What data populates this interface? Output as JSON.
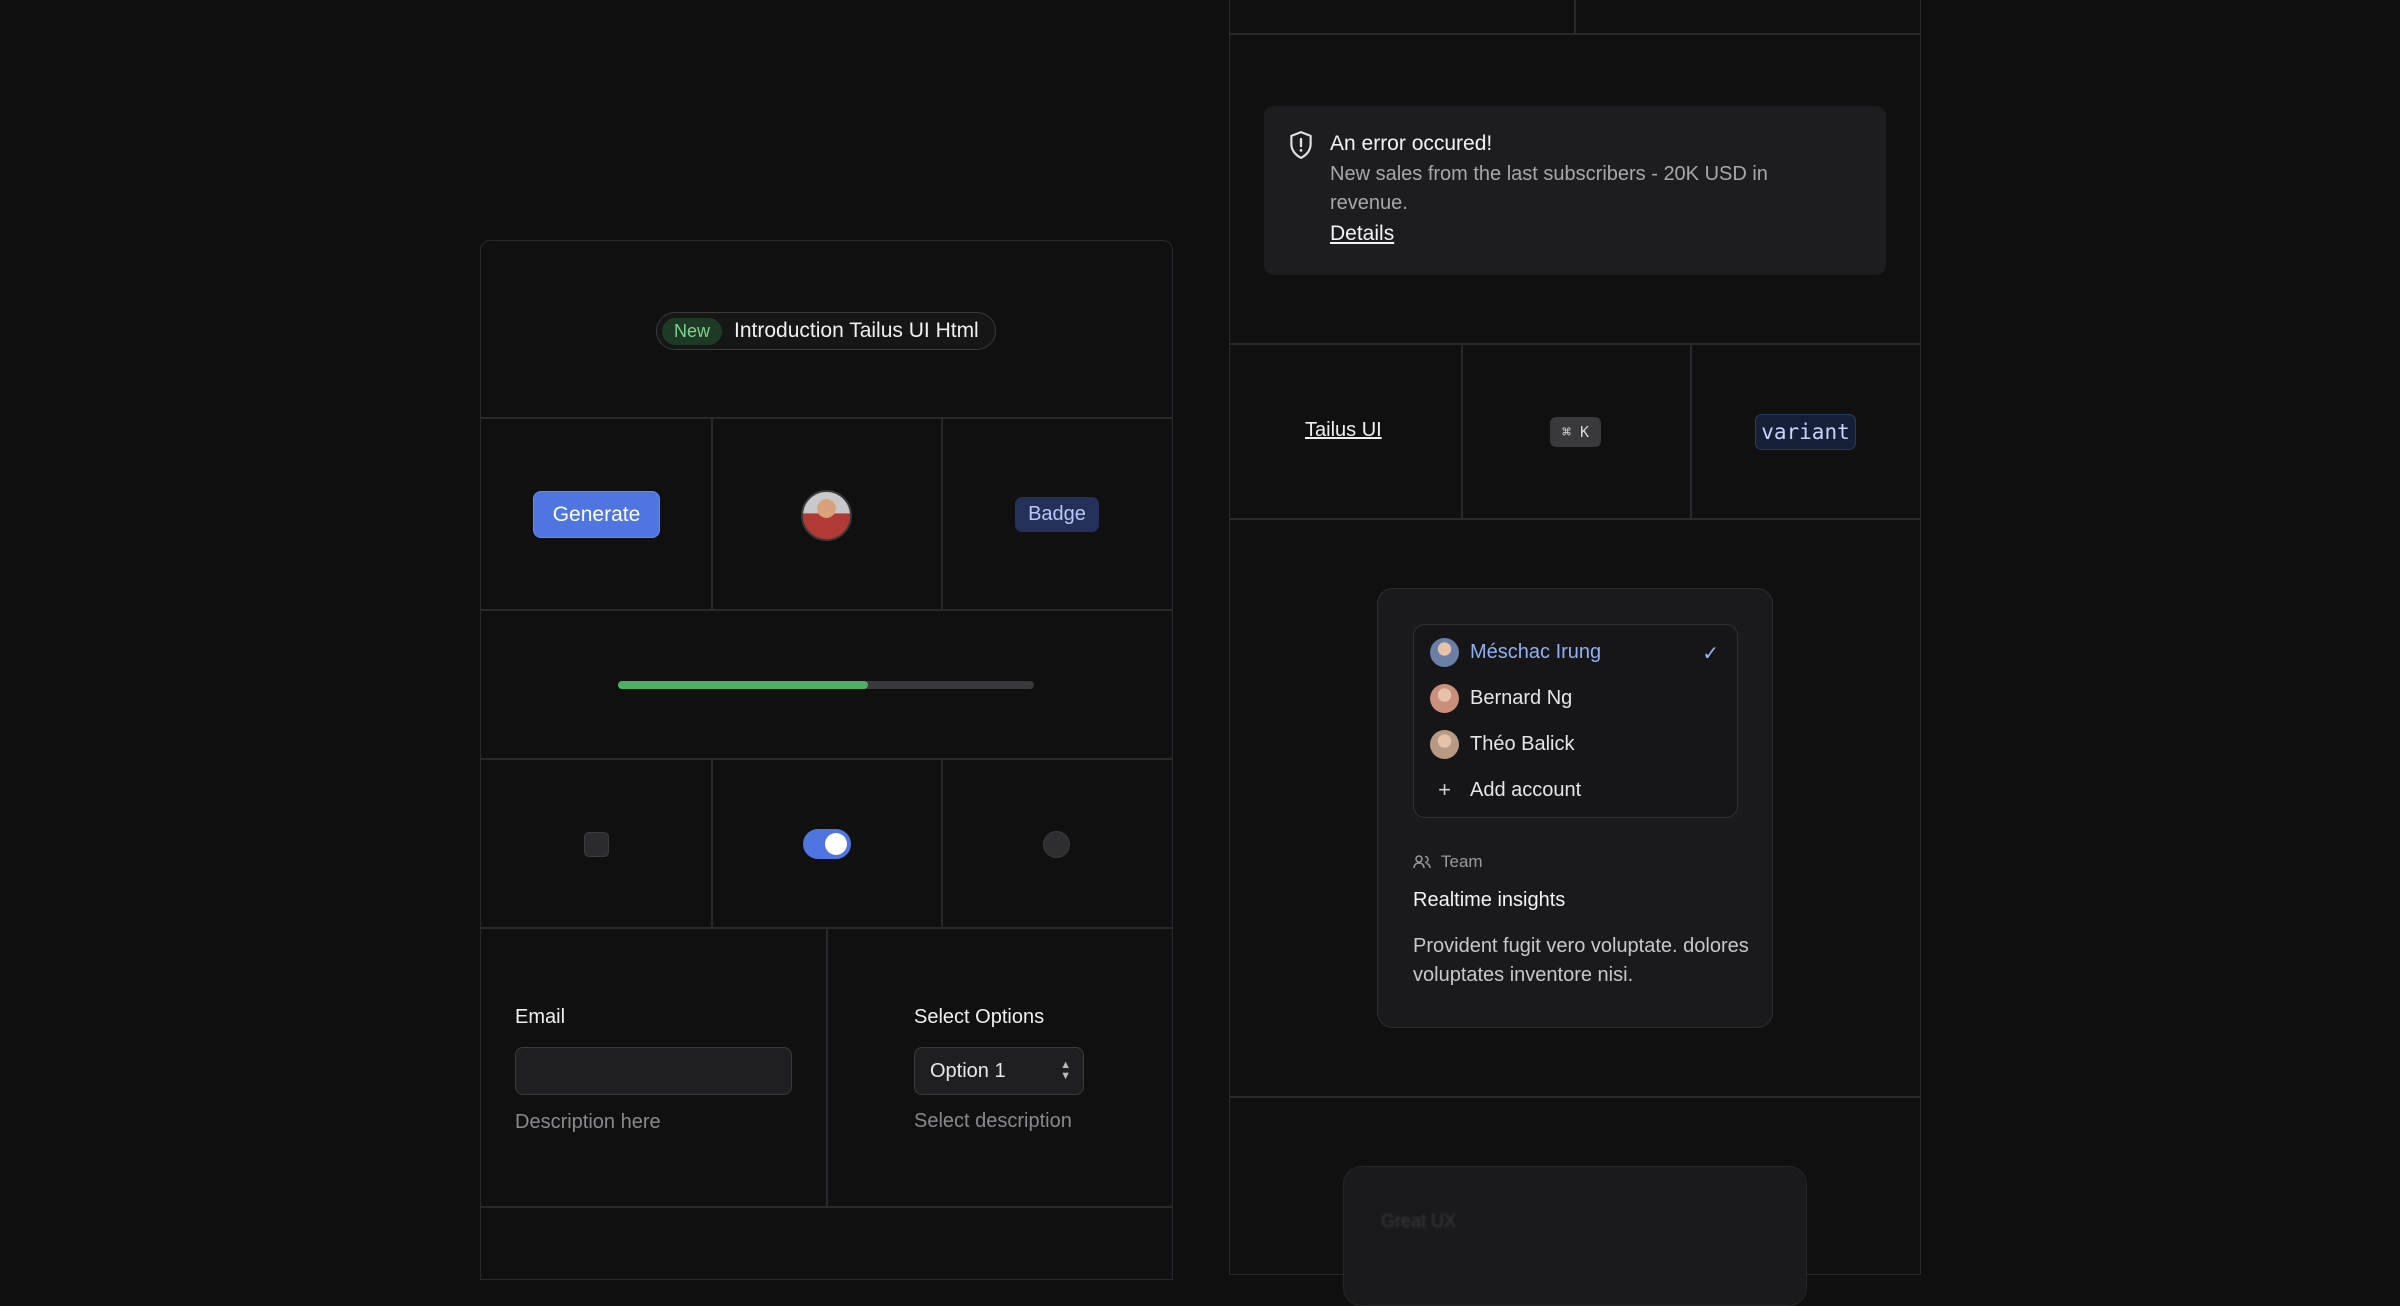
{
  "left": {
    "announcement": {
      "tag": "New",
      "text": "Introduction Tailus UI Html"
    },
    "generate_label": "Generate",
    "badge_label": "Badge",
    "progress": {
      "percent": 60
    },
    "toggle_on": true,
    "email": {
      "label": "Email",
      "value": "",
      "description": "Description here"
    },
    "select": {
      "label": "Select Options",
      "value": "Option 1",
      "description": "Select description"
    }
  },
  "right": {
    "alert": {
      "title": "An error occured!",
      "body": "New sales from the last subscribers - 20K USD in revenue.",
      "link": "Details"
    },
    "link_label": "Tailus UI",
    "kbd": "⌘ K",
    "code": "variant",
    "accounts": [
      {
        "name": "Méschac Irung",
        "active": true,
        "avatar_color": "#6a7fa8"
      },
      {
        "name": "Bernard Ng",
        "active": false,
        "avatar_color": "#c98f7a"
      },
      {
        "name": "Théo Balick",
        "active": false,
        "avatar_color": "#b89a84"
      }
    ],
    "add_account": "Add account",
    "team_label": "Team",
    "card_title": "Realtime insights",
    "card_text": "Provident fugit vero voluptate. dolores voluptates inventore nisi.",
    "faded_label": "Great UX"
  },
  "colors": {
    "accent": "#4f75e0",
    "progress": "#4caf62",
    "background": "#0f0f10"
  }
}
